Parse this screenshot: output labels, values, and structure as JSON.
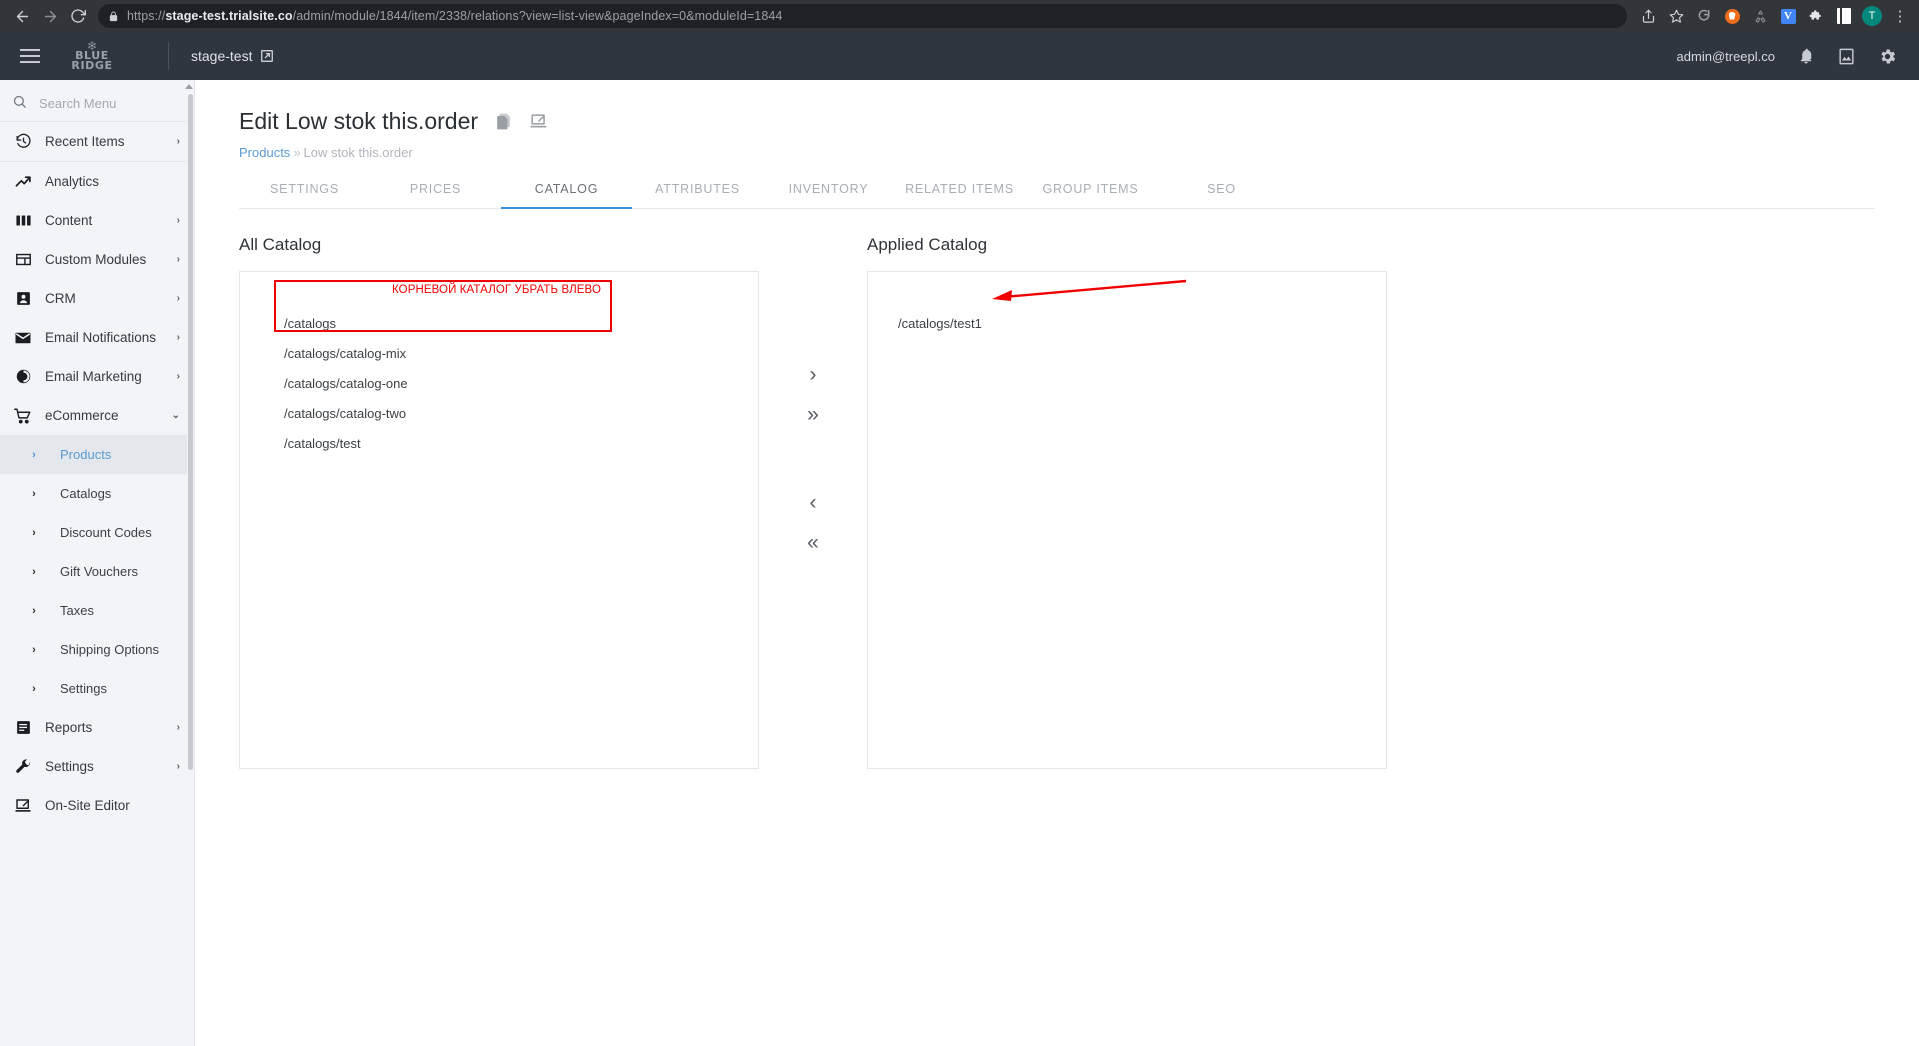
{
  "browser": {
    "back_icon": "back-arrow-icon",
    "forward_icon": "forward-arrow-icon",
    "reload_icon": "reload-icon",
    "lock_icon": "lock-icon",
    "url_scheme": "https://",
    "url_host": "stage-test.trialsite.co",
    "url_path": "/admin/module/1844/item/2338/relations?view=list-view&pageIndex=0&moduleId=1844",
    "toolbar_icons": [
      "share-icon",
      "bookmark-star-icon",
      "extension-loop-icon",
      "extension-orange-icon",
      "extension-recycle-icon",
      "extension-v-icon",
      "extension-puzzle-icon",
      "side-panel-icon",
      "profile-avatar",
      "kebab-menu-icon"
    ],
    "profile_initial": "T",
    "ext_v_label": "V"
  },
  "header": {
    "menu_icon": "hamburger-menu-icon",
    "logo_line1": "BLUE",
    "logo_line2": "RIDGE",
    "site_name": "stage-test",
    "site_link_icon": "external-link-icon",
    "user_email": "admin@treepl.co",
    "notification_icon": "bell-icon",
    "media_icon": "image-icon",
    "settings_icon": "gear-icon"
  },
  "sidebar": {
    "search_placeholder": "Search Menu",
    "search_icon": "search-icon",
    "recent": {
      "label": "Recent Items",
      "icon": "history-clock-icon",
      "chevron": "›"
    },
    "items": [
      {
        "label": "Analytics",
        "icon": "trend-up-icon",
        "chevron": ""
      },
      {
        "label": "Content",
        "icon": "columns-icon",
        "chevron": "›"
      },
      {
        "label": "Custom Modules",
        "icon": "table-icon",
        "chevron": "›"
      },
      {
        "label": "CRM",
        "icon": "user-icon",
        "chevron": "›"
      },
      {
        "label": "Email Notifications",
        "icon": "envelope-icon",
        "chevron": "›"
      },
      {
        "label": "Email Marketing",
        "icon": "pie-chart-icon",
        "chevron": "›"
      },
      {
        "label": "eCommerce",
        "icon": "shopping-cart-icon",
        "chevron": "⌄"
      }
    ],
    "ecommerce_children": [
      {
        "label": "Products",
        "active": true
      },
      {
        "label": "Catalogs",
        "active": false
      },
      {
        "label": "Discount Codes",
        "active": false
      },
      {
        "label": "Gift Vouchers",
        "active": false
      },
      {
        "label": "Taxes",
        "active": false
      },
      {
        "label": "Shipping Options",
        "active": false
      },
      {
        "label": "Settings",
        "active": false
      }
    ],
    "bottom_items": [
      {
        "label": "Reports",
        "icon": "report-icon",
        "chevron": "›"
      },
      {
        "label": "Settings",
        "icon": "wrench-icon",
        "chevron": "›"
      },
      {
        "label": "On-Site Editor",
        "icon": "edit-screen-icon",
        "chevron": ""
      }
    ]
  },
  "page": {
    "title": "Edit Low stok this.order",
    "copy_icon": "duplicate-icon",
    "edit_icon": "edit-icon",
    "breadcrumb_root": "Products",
    "breadcrumb_sep": "»",
    "breadcrumb_current": "Low stok this.order"
  },
  "tabs": [
    {
      "label": "SETTINGS",
      "active": false
    },
    {
      "label": "PRICES",
      "active": false
    },
    {
      "label": "CATALOG",
      "active": true
    },
    {
      "label": "ATTRIBUTES",
      "active": false
    },
    {
      "label": "INVENTORY",
      "active": false
    },
    {
      "label": "RELATED ITEMS",
      "active": false
    },
    {
      "label": "GROUP ITEMS",
      "active": false
    },
    {
      "label": "SEO",
      "active": false
    }
  ],
  "catalog": {
    "all_title": "All Catalog",
    "applied_title": "Applied Catalog",
    "all_items": [
      "/catalogs",
      "/catalogs/catalog-mix",
      "/catalogs/catalog-one",
      "/catalogs/catalog-two",
      "/catalogs/test"
    ],
    "applied_items": [
      "/catalogs/test1"
    ],
    "annotation_text": "КОРНЕВОЙ КАТАЛОГ УБРАТЬ ВЛЕВО",
    "annotation_color": "#f20000",
    "transfer_buttons": [
      {
        "name": "move-right",
        "glyph": "›"
      },
      {
        "name": "move-all-right",
        "glyph": "»"
      },
      {
        "name": "move-left",
        "glyph": "‹"
      },
      {
        "name": "move-all-left",
        "glyph": "«"
      }
    ]
  }
}
